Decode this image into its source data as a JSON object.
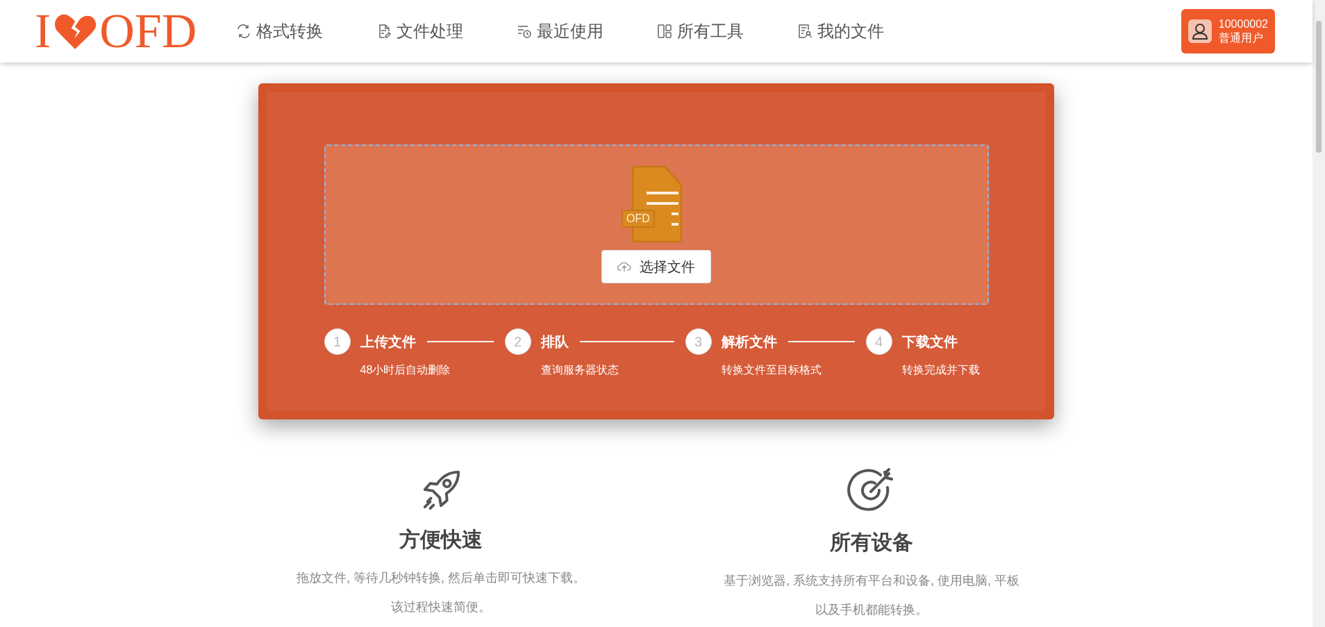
{
  "logo": {
    "left": "I",
    "right": "OFD"
  },
  "nav": [
    {
      "label": "格式转换",
      "kind": "convert"
    },
    {
      "label": "文件处理",
      "kind": "edit"
    },
    {
      "label": "最近使用",
      "kind": "recent"
    },
    {
      "label": "所有工具",
      "kind": "tools"
    },
    {
      "label": "我的文件",
      "kind": "files"
    }
  ],
  "user": {
    "id": "10000002",
    "role": "普通用户"
  },
  "upload": {
    "badge": "OFD",
    "button": "选择文件"
  },
  "steps": [
    {
      "number": "1",
      "title": "上传文件",
      "subtitle": "48小时后自动删除"
    },
    {
      "number": "2",
      "title": "排队",
      "subtitle": "查询服务器状态"
    },
    {
      "number": "3",
      "title": "解析文件",
      "subtitle": "转换文件至目标格式"
    },
    {
      "number": "4",
      "title": "下载文件",
      "subtitle": "转换完成并下载"
    }
  ],
  "features": [
    {
      "kind": "rocket",
      "title": "方便快速",
      "text": "拖放文件, 等待几秒钟转换, 然后单击即可快速下载。该过程快速简便。"
    },
    {
      "kind": "target",
      "title": "所有设备",
      "text": "基于浏览器, 系统支持所有平台和设备, 使用电脑, 平板以及手机都能转换。"
    }
  ]
}
